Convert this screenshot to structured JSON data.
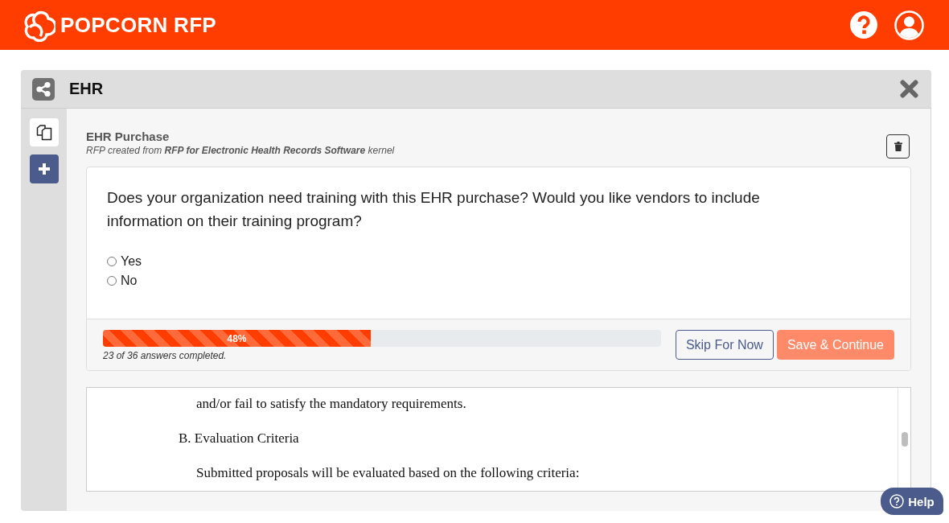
{
  "header": {
    "logo_text": "POPCORN RFP"
  },
  "panel": {
    "title": "EHR"
  },
  "rfp": {
    "title": "EHR Purchase",
    "subtitle": "RFP created from **RFP for Electronic Health Records Software** kernel"
  },
  "question": {
    "text": "Does your organization need training with this EHR purchase? Would you like vendors to include information on their training program?",
    "options": [
      {
        "label": "Yes",
        "selected": false
      },
      {
        "label": "No",
        "selected": false
      }
    ]
  },
  "progress": {
    "level": 0.48,
    "label": "48%",
    "caption": "23 of 36 answers completed."
  },
  "buttons": [
    {
      "label": "Skip For Now",
      "kind": "secondary"
    },
    {
      "label": "Save & Continue",
      "kind": "primary"
    }
  ],
  "document": {
    "paragraphs": [
      {
        "kind": "body",
        "text": "and/or fail to satisfy the mandatory requirements."
      },
      {
        "kind": "heading",
        "text": "B. Evaluation Criteria"
      },
      {
        "kind": "body",
        "text": "Submitted proposals will be evaluated based on the following criteria:"
      }
    ]
  },
  "help_button": {
    "label": "Help"
  }
}
